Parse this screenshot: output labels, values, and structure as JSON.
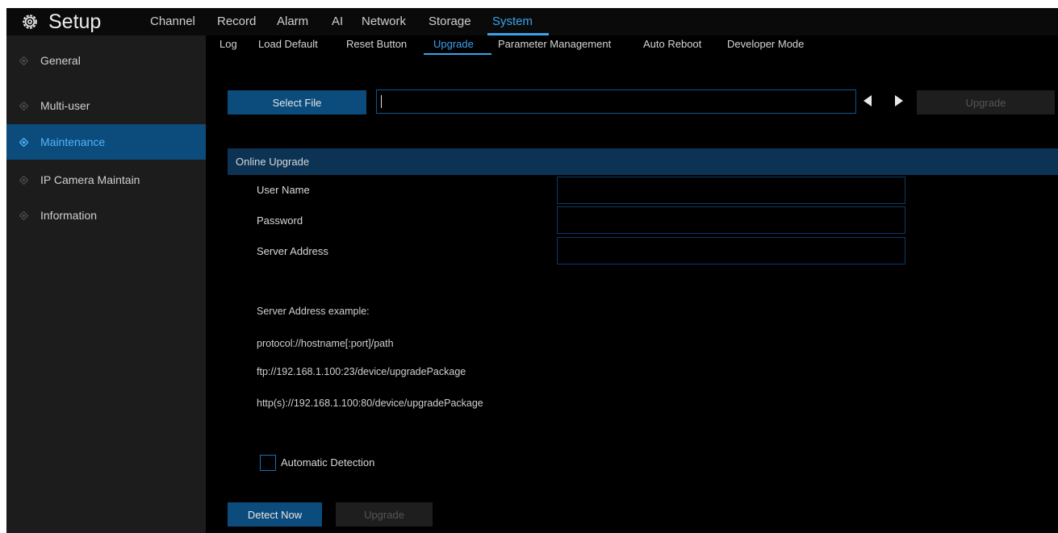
{
  "header": {
    "title": "Setup",
    "gear_icon": "gear-icon",
    "menu": [
      {
        "label": "Channel"
      },
      {
        "label": "Record"
      },
      {
        "label": "Alarm"
      },
      {
        "label": "AI"
      },
      {
        "label": "Network"
      },
      {
        "label": "Storage"
      },
      {
        "label": "System",
        "active": true
      }
    ]
  },
  "sidebar": {
    "items": [
      {
        "label": "General"
      },
      {
        "label": "Multi-user"
      },
      {
        "label": "Maintenance",
        "active": true
      },
      {
        "label": "IP Camera Maintain"
      },
      {
        "label": "Information"
      }
    ]
  },
  "tabs": [
    {
      "label": "Log"
    },
    {
      "label": "Load Default"
    },
    {
      "label": "Reset Button"
    },
    {
      "label": "Upgrade",
      "active": true
    },
    {
      "label": "Parameter Management"
    },
    {
      "label": "Auto Reboot"
    },
    {
      "label": "Developer Mode"
    }
  ],
  "upgrade": {
    "select_file_label": "Select File",
    "file_path_value": "",
    "upgrade_label": "Upgrade"
  },
  "online": {
    "section_title": "Online Upgrade",
    "user_name_label": "User Name",
    "password_label": "Password",
    "server_address_label": "Server Address",
    "user_name_value": "",
    "password_value": "",
    "server_address_value": "",
    "example_title": "Server Address example:",
    "example_format": "protocol://hostname[:port]/path",
    "example_ftp": "ftp://192.168.1.100:23/device/upgradePackage",
    "example_http": "http(s)://192.168.1.100:80/device/upgradePackage",
    "auto_detect_label": "Automatic Detection",
    "auto_detect_checked": false,
    "detect_now_label": "Detect Now",
    "upgrade_label": "Upgrade"
  },
  "colors": {
    "accent": "#3aa3ec",
    "active_bg": "#0c4c7c",
    "section_bg": "#0c3354"
  }
}
